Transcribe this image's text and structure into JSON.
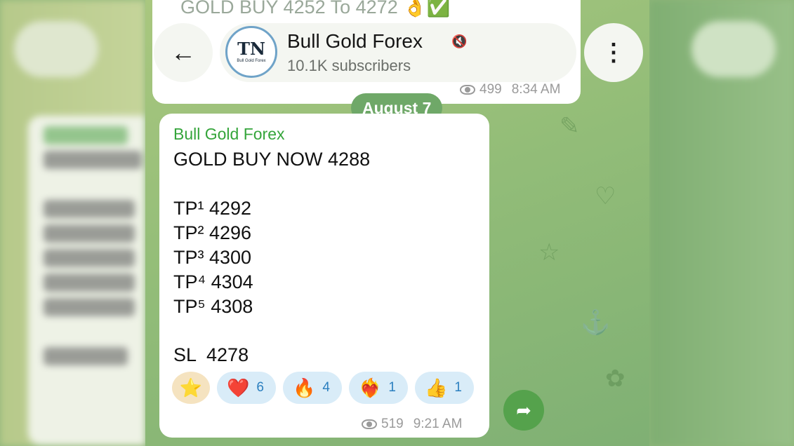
{
  "header": {
    "channel_name": "Bull Gold Forex",
    "subscribers": "10.1K subscribers",
    "avatar_caption": "Bull Gold Forex"
  },
  "previous_message": {
    "text": "GOLD BUY 4252 To 4272 👌✅",
    "views": "499",
    "time": "8:34 AM"
  },
  "date_separator": "August 7",
  "message": {
    "sender": "Bull Gold Forex",
    "lines": [
      "GOLD BUY NOW 4288",
      "TP¹ 4292",
      "TP² 4296",
      "TP³ 4300",
      "TP⁴ 4304",
      "TP⁵ 4308",
      "SL  4278"
    ],
    "views": "519",
    "time": "9:21 AM",
    "reactions": [
      {
        "emoji": "⭐",
        "icon": "star-icon",
        "count": ""
      },
      {
        "emoji": "❤️",
        "icon": "heart-icon",
        "count": "6"
      },
      {
        "emoji": "🔥",
        "icon": "fire-icon",
        "count": "4"
      },
      {
        "emoji": "❤️‍🔥",
        "icon": "heart-on-fire-icon",
        "count": "1"
      },
      {
        "emoji": "👍",
        "icon": "thumbs-up-icon",
        "count": "1"
      }
    ]
  },
  "icons": {
    "back": "←",
    "menu": "⋮",
    "mute": "🔇",
    "forward": "➦"
  },
  "colors": {
    "sender": "#35a53b",
    "date_chip": "#6fa868",
    "reaction_pill": "#d9ecf8",
    "forward_button": "#55a24c"
  }
}
